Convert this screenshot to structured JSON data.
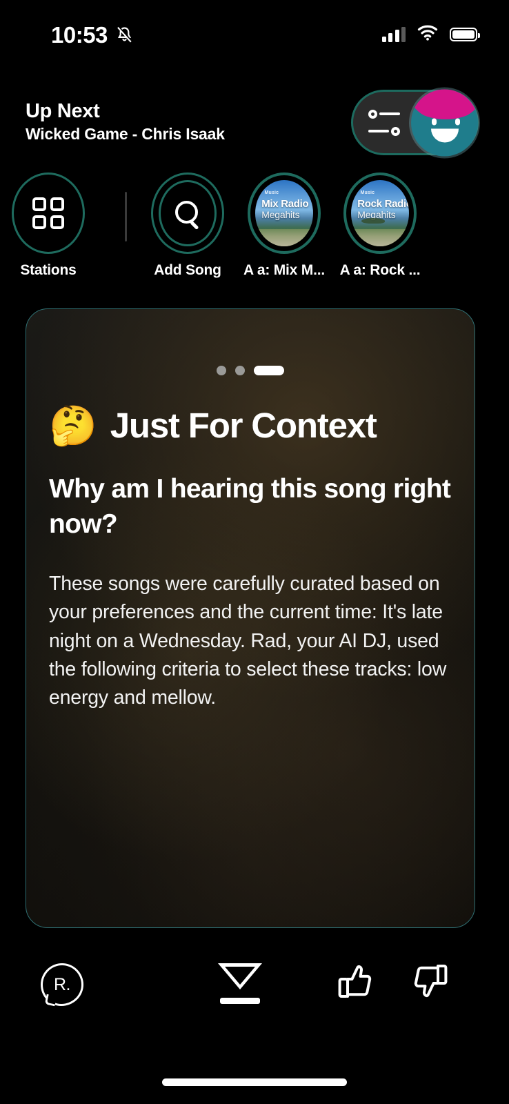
{
  "status_bar": {
    "time": "10:53",
    "silent_icon": "bell-muted-icon",
    "signal_icon": "cellular-signal-icon",
    "signal_bars_filled": 3,
    "signal_bars_total": 4,
    "wifi_icon": "wifi-icon",
    "battery_icon": "battery-full-icon",
    "battery_level": 100
  },
  "header": {
    "title": "Up Next",
    "subtitle": "Wicked Game - Chris Isaak",
    "pill": {
      "settings_icon": "sliders-icon",
      "avatar_icon": "dj-avatar-icon",
      "avatar_hair_color": "#d5148a",
      "avatar_face_color": "#1f7d8c",
      "border_color": "#1d6b5f",
      "background_color": "#2b2b2b"
    }
  },
  "quick_actions": {
    "accent_color": "#1e6b5e",
    "items": [
      {
        "label": "Add Song",
        "icon": "search-icon",
        "type": "icon"
      },
      {
        "label": "A a: Mix M...",
        "icon": "station-artwork",
        "type": "artwork",
        "artwork": {
          "wordmark": "Music",
          "line1": "Mix Radio",
          "line2": "Megahits"
        }
      },
      {
        "label": "A a: Rock ...",
        "icon": "station-artwork",
        "type": "artwork",
        "artwork": {
          "wordmark": "Music",
          "line1": "Rock Radio",
          "line2": "Megahits"
        }
      },
      {
        "label": "Stations",
        "icon": "grid-icon",
        "type": "icon"
      }
    ]
  },
  "card": {
    "pager": {
      "total": 3,
      "active_index": 2
    },
    "emoji": "🤔",
    "title": "Just For Context",
    "question": "Why am I hearing this song right now?",
    "body": "These songs were carefully curated based on your preferences and the current time: It's late night on a Wednesday. Rad, your AI DJ, used the following criteria to select these tracks: low energy and mellow.",
    "border_color": "#2f6f72"
  },
  "toolbar": {
    "rad_label": "R.",
    "rad_icon": "rad-speech-bubble-icon",
    "collapse_icon": "collapse-down-icon",
    "thumbs_up_icon": "thumbs-up-icon",
    "thumbs_down_icon": "thumbs-down-icon"
  }
}
